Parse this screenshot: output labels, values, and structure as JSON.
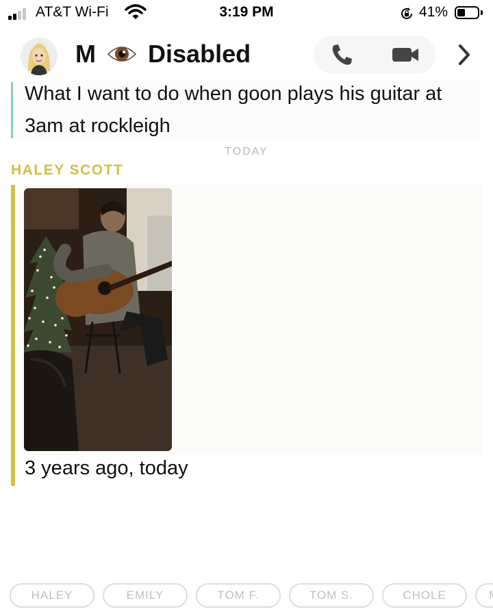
{
  "status_bar": {
    "carrier": "AT&T Wi-Fi",
    "time": "3:19 PM",
    "battery_percent": "41%",
    "battery_level": 0.41,
    "icons": [
      "signal-icon",
      "wifi-icon",
      "rotation-lock-icon",
      "battery-icon"
    ]
  },
  "header": {
    "title_prefix": "M",
    "title_suffix": "Disabled",
    "icons": [
      "avatar",
      "eye-emoji-icon",
      "phone-icon",
      "video-camera-icon",
      "chevron-right-icon"
    ]
  },
  "messages": {
    "previous_text": "What I want to do when goon plays his guitar at 3am at rockleigh",
    "date_separator": "TODAY",
    "sender": "HALEY SCOTT",
    "caption": "3 years ago, today"
  },
  "suggestions": [
    "HALEY",
    "EMILY",
    "TOM F.",
    "TOM S.",
    "CHOLE",
    "M"
  ],
  "colors": {
    "accent_sender": "#d2c143",
    "previous_message_bar": "#7dcfb6",
    "muted_text": "#b8b8b8"
  }
}
